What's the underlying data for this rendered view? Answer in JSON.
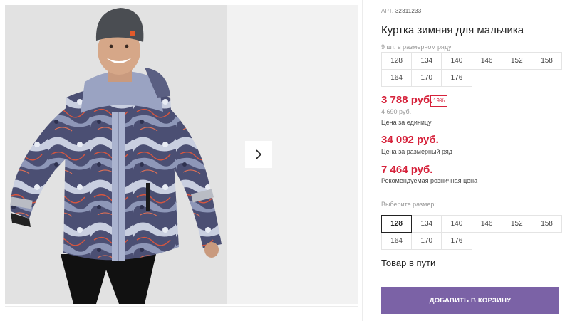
{
  "product": {
    "sku_label": "АРТ.",
    "sku": "32311233",
    "title": "Куртка зимняя для мальчика",
    "pack_label": "9 шт. в размерном ряду",
    "pack_sizes": [
      "128",
      "134",
      "140",
      "146",
      "152",
      "158",
      "164",
      "170",
      "176"
    ]
  },
  "prices": {
    "unit_price": "3 788 руб.",
    "discount": "19%",
    "old_price": "4 690 руб.",
    "unit_caption": "Цена за единицу",
    "pack_price": "34 092 руб.",
    "pack_caption": "Цена за размерный ряд",
    "retail_price": "7 464 руб.",
    "retail_caption": "Рекомендуемая розничная цена"
  },
  "size_select": {
    "label": "Выберите размер:",
    "sizes": [
      "128",
      "134",
      "140",
      "146",
      "152",
      "158",
      "164",
      "170",
      "176"
    ],
    "selected": "128"
  },
  "availability": "Товар в пути",
  "cart_button": "ДОБАВИТЬ В КОРЗИНУ",
  "gallery": {
    "next_icon": "chevron-right-icon"
  },
  "colors": {
    "accent_price": "#d6223b",
    "cart_button": "#7b62a6",
    "jacket_print": "#3e4366",
    "hat": "#4a4d52"
  }
}
